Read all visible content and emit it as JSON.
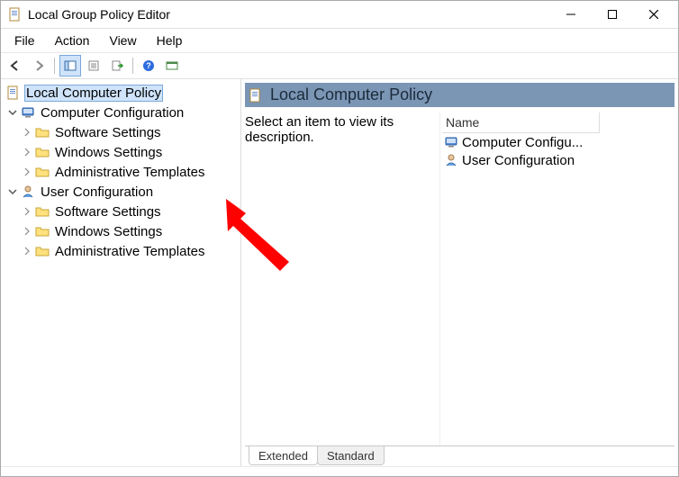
{
  "window": {
    "title": "Local Group Policy Editor"
  },
  "menu": {
    "file": "File",
    "action": "Action",
    "view": "View",
    "help": "Help"
  },
  "tree": {
    "root": "Local Computer Policy",
    "computer": "Computer Configuration",
    "user": "User Configuration",
    "software": "Software Settings",
    "windows": "Windows Settings",
    "admin": "Administrative Templates"
  },
  "panel": {
    "title": "Local Computer Policy",
    "description": "Select an item to view its description.",
    "header_name": "Name",
    "item_computer": "Computer Configu...",
    "item_user": "User Configuration"
  },
  "tabs": {
    "extended": "Extended",
    "standard": "Standard"
  }
}
